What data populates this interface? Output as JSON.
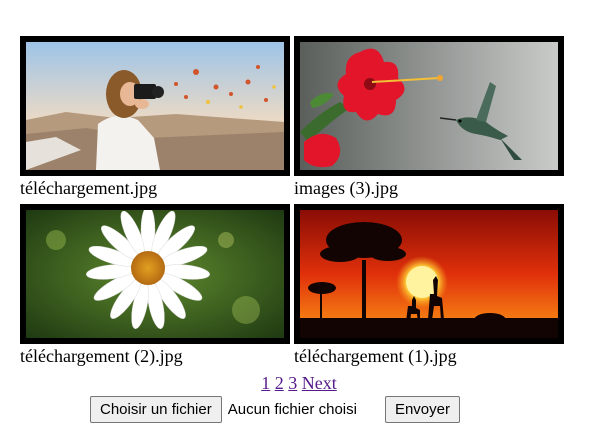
{
  "gallery": {
    "items": [
      {
        "filename": "téléchargement.jpg",
        "subject": "woman-photographer-with-hot-air-balloons"
      },
      {
        "filename": "images (3).jpg",
        "subject": "hummingbird-and-red-hibiscus"
      },
      {
        "filename": "téléchargement (2).jpg",
        "subject": "white-daisy"
      },
      {
        "filename": "téléchargement (1).jpg",
        "subject": "african-sunset-with-giraffes"
      }
    ]
  },
  "pagination": {
    "pages": [
      "1",
      "2",
      "3"
    ],
    "next_label": "Next"
  },
  "upload": {
    "choose_button_label": "Choisir un fichier",
    "no_file_text": "Aucun fichier choisi",
    "submit_button_label": "Envoyer"
  },
  "colors": {
    "link": "#551a8b",
    "frame": "#000000",
    "button_bg": "#efefef"
  }
}
